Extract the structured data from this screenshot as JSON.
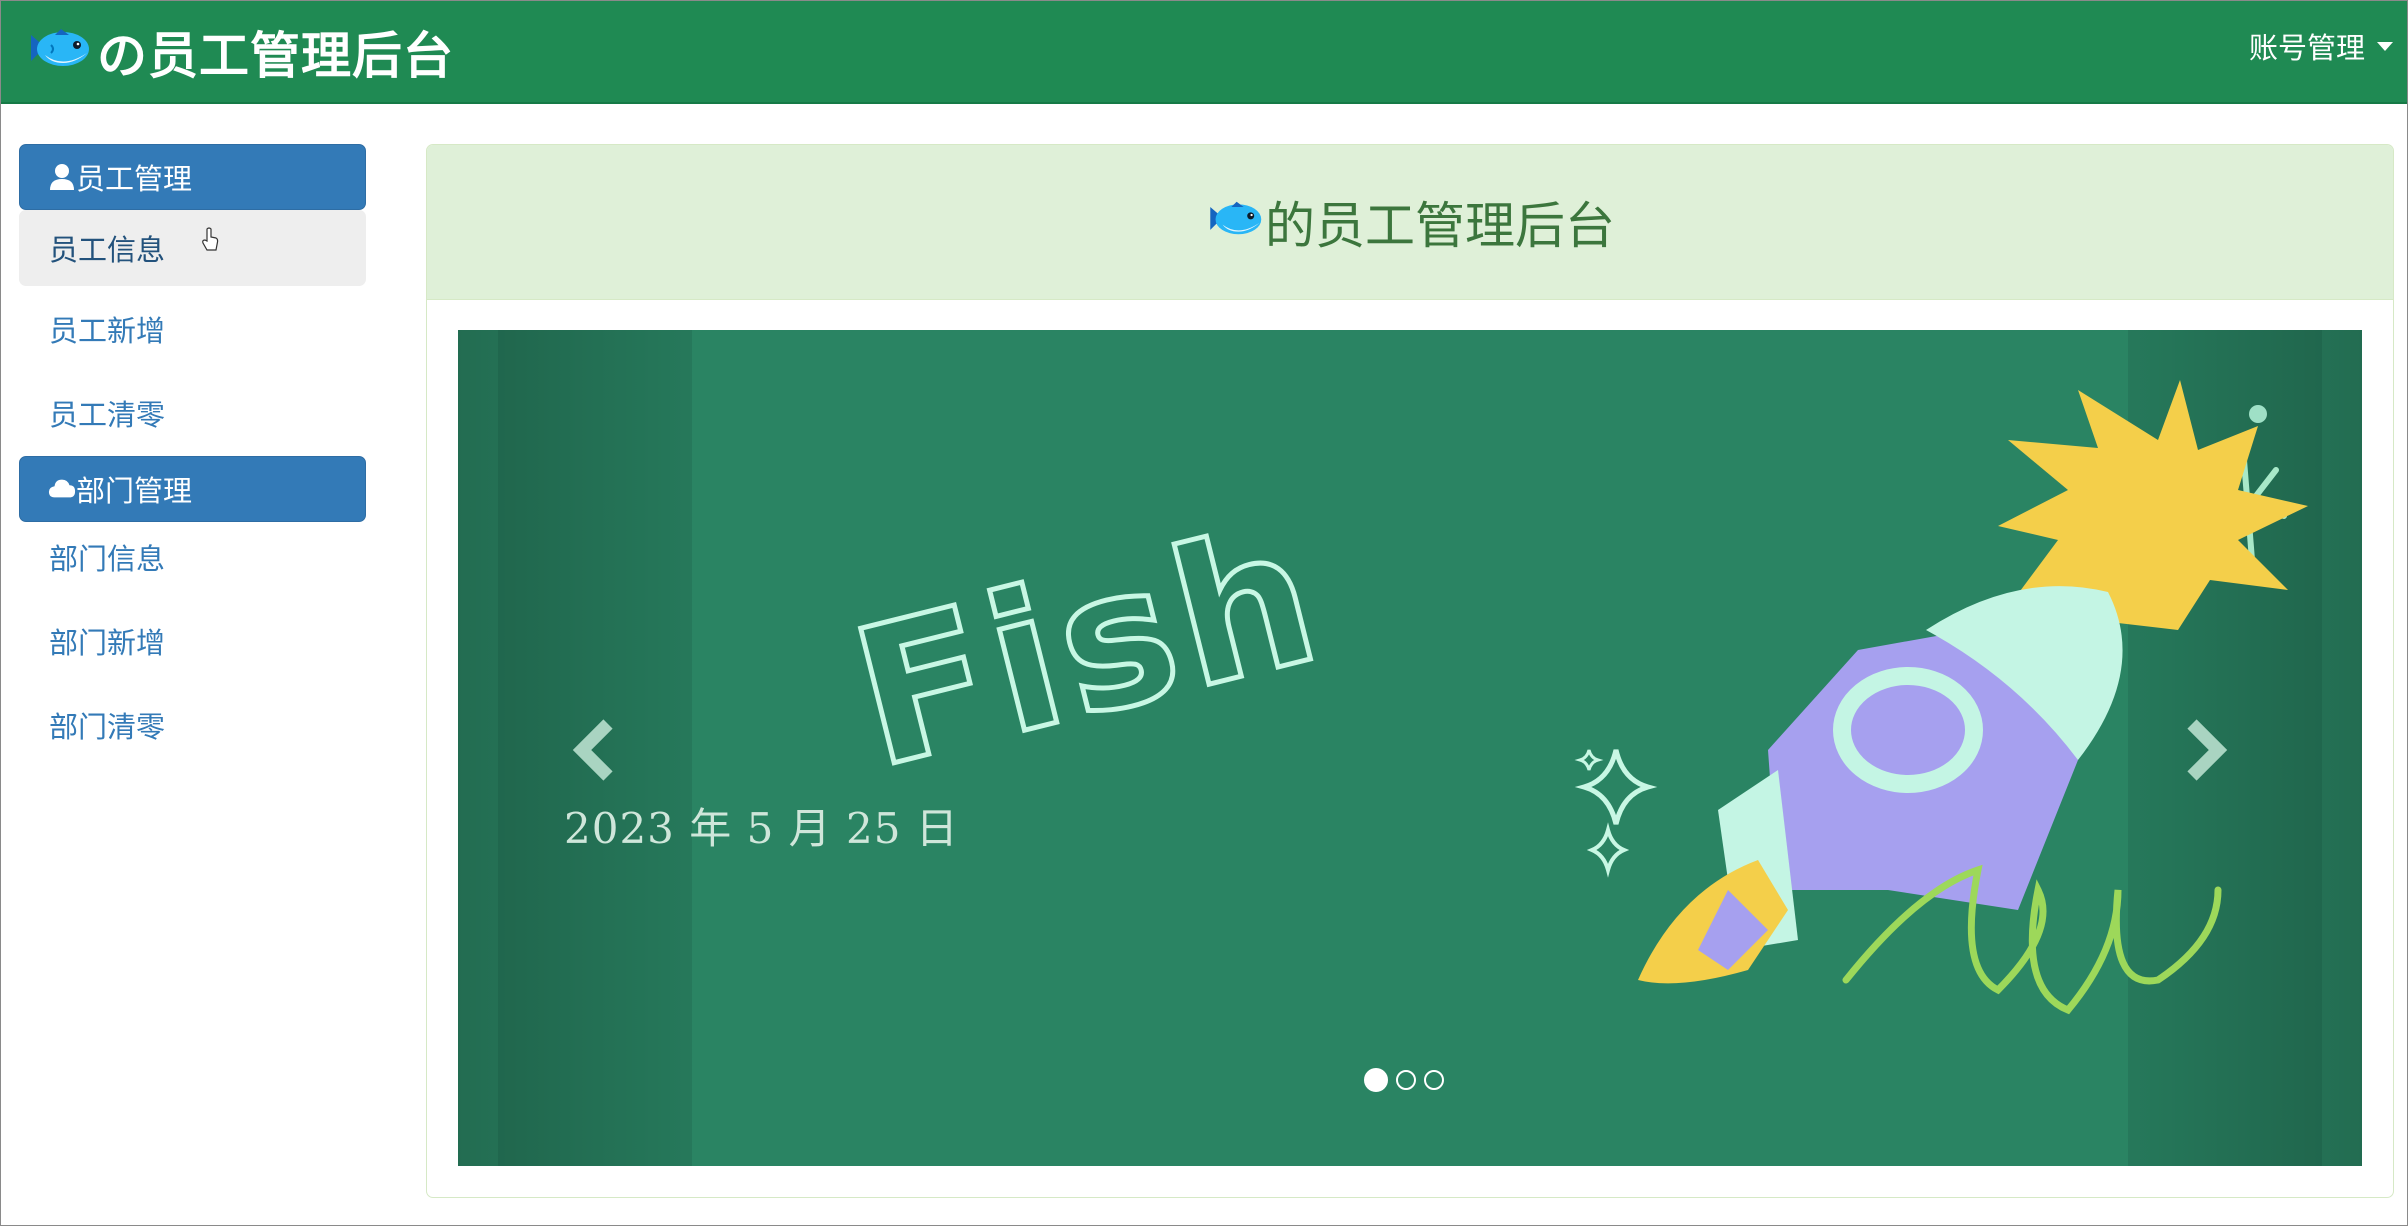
{
  "navbar": {
    "brand_title": "の员工管理后台",
    "brand_icon": "fish-icon",
    "account_menu_label": "账号管理"
  },
  "sidebar": {
    "groups": [
      {
        "title": "员工管理",
        "icon": "user-icon",
        "items": [
          {
            "label": "员工信息",
            "active": true
          },
          {
            "label": "员工新增"
          },
          {
            "label": "员工清零"
          }
        ]
      },
      {
        "title": "部门管理",
        "icon": "cloud-icon",
        "items": [
          {
            "label": "部门信息"
          },
          {
            "label": "部门新增"
          },
          {
            "label": "部门清零"
          }
        ]
      }
    ]
  },
  "panel": {
    "heading": "的员工管理后台",
    "heading_icon": "fish-icon"
  },
  "carousel": {
    "slide_caption": "2023 年 5 月 25 日",
    "slide_art_text": "Fish",
    "slide_count": 3,
    "active_slide": 1
  },
  "colors": {
    "navbar": "#1f8a53",
    "sidebar_group": "#337ab7",
    "panel_heading_bg": "#dff0d8",
    "panel_heading_text": "#3c763d",
    "carousel_bg": "#2a8463"
  }
}
